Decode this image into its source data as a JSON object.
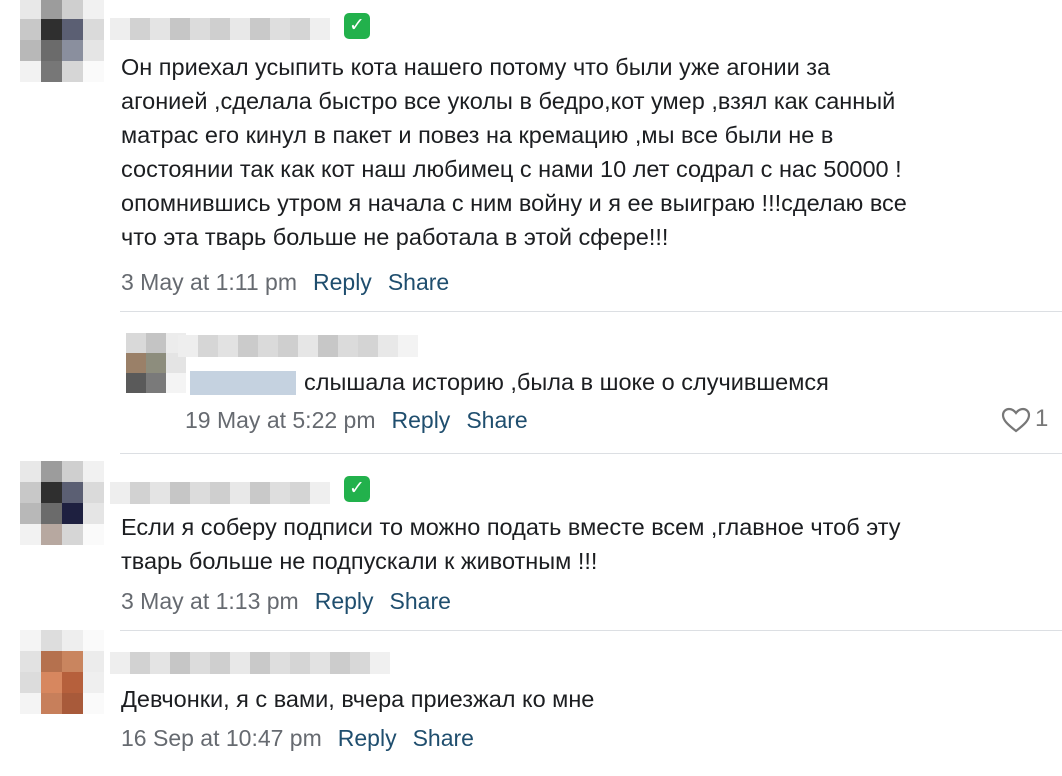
{
  "comments": [
    {
      "text": "Он приехал усыпить кота нашего потому что были уже агонии за\nагонией ,сделала быстро все уколы в бедро,кот умер ,взял как санный\nматрас его кинул в пакет и повез на кремацию ,мы все были не в\nсостоянии так как кот наш любимец с нами 10 лет содрал с нас 50000 !\nопомнившись утром я начала с ним войну и я ее выиграю !!!сделаю все\nчто эта тварь больше не работала в этой сфере!!!",
      "time": "3 May at 1:11 pm",
      "reply_label": "Reply",
      "share_label": "Share",
      "badge": "✓"
    },
    {
      "text": "слышала историю ,была в шоке о случившемся",
      "time": "19 May at 5:22 pm",
      "reply_label": "Reply",
      "share_label": "Share",
      "like_count": "1",
      "icon": "heart-icon"
    },
    {
      "text": "Если я соберу подписи то можно подать вместе всем ,главное чтоб эту\nтварь больше не подпускали к животным !!!",
      "time": "3 May at 1:13 pm",
      "reply_label": "Reply",
      "share_label": "Share",
      "badge": "✓"
    },
    {
      "text": "Девчонки, я с вами, вчера приезжал ко мне",
      "time": "16 Sep at 10:47 pm",
      "reply_label": "Reply",
      "share_label": "Share"
    }
  ],
  "colors": {
    "link": "#1f4e6e",
    "timestamp": "#666a70",
    "verified": "#22b14c"
  }
}
